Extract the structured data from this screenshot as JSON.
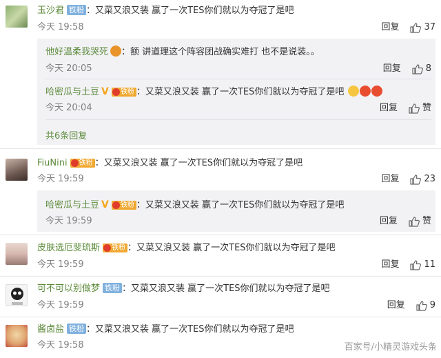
{
  "comments": [
    {
      "username": "玉沙君",
      "badge": "铁粉",
      "text": "：又菜又浪又装  赢了一次TES你们就以为夺冠了是吧",
      "time": "今天 19:58",
      "reply": "回复",
      "likes": "37",
      "subreplies": [
        {
          "username": "他好温柔我哭死",
          "text": "：额  讲道理这个阵容团战确实难打  也不是说装。。",
          "time": "今天 20:05",
          "reply": "回复",
          "likes": "8"
        },
        {
          "username": "哈密瓜与土豆",
          "badge": "铁粉",
          "text": "：又菜又浪又装  赢了一次TES你们就以为夺冠了是吧",
          "time": "今天 20:04",
          "reply": "回复",
          "likes": "赞"
        }
      ],
      "more": "共6条回复"
    },
    {
      "username": "FiuNini",
      "badge": "铁粉",
      "text": "：又菜又浪又装  赢了一次TES你们就以为夺冠了是吧",
      "time": "今天 19:59",
      "reply": "回复",
      "likes": "23",
      "subreplies": [
        {
          "username": "哈密瓜与土豆",
          "badge": "铁粉",
          "text": "：又菜又浪又装  赢了一次TES你们就以为夺冠了是吧",
          "time": "今天 19:59",
          "reply": "回复",
          "likes": "赞"
        }
      ]
    },
    {
      "username": "皮肤选厄斐琉斯",
      "badge": "铁粉",
      "text": "：又菜又浪又装  赢了一次TES你们就以为夺冠了是吧",
      "time": "今天 19:59",
      "reply": "回复",
      "likes": "11"
    },
    {
      "username": "可不可以别做梦",
      "badge": "铁粉",
      "text": "：又菜又浪又装  赢了一次TES你们就以为夺冠了是吧",
      "time": "今天 19:59",
      "reply": "回复",
      "likes": "9"
    },
    {
      "username": "酱卤盐",
      "badge": "铁粉",
      "text": "：又菜又浪又装  赢了一次TES你们就以为夺冠了是吧",
      "time": "今天 19:58",
      "reply": "回复",
      "likes": ""
    }
  ],
  "watermark": "百家号/小精灵游戏头条",
  "colors": {
    "username": "#5c8a3a",
    "badge_blue": "#7fb0de",
    "badge_orange": "#f0a830",
    "subbox_bg": "#f2f2f5"
  }
}
